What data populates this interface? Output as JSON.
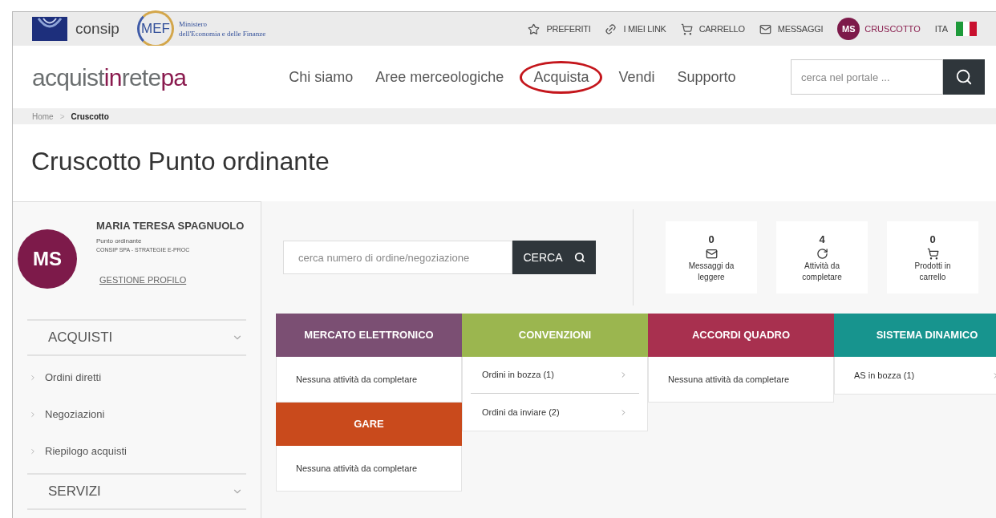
{
  "topbar": {
    "consip": "consip",
    "mef": "MEF",
    "ministry_line_1": "Ministero",
    "ministry_line_2": "dell'Economia e delle Finanze",
    "links": [
      {
        "kind": "star",
        "label": "PREFERITI"
      },
      {
        "kind": "link",
        "label": "I MIEI LINK"
      },
      {
        "kind": "cart",
        "label": "CARRELLO"
      },
      {
        "kind": "mail",
        "label": "MESSAGGI"
      }
    ],
    "user_initials": "MS",
    "dashboard": "CRUSCOTTO",
    "language": "ITA"
  },
  "header": {
    "logo": [
      {
        "text": "acquist",
        "highlighted": false
      },
      {
        "text": "in",
        "highlighted": true
      },
      {
        "text": "rete",
        "highlighted": false
      },
      {
        "text": "pa",
        "highlighted": true
      }
    ],
    "nav": [
      {
        "label": "Chi siamo",
        "circled": false
      },
      {
        "label": "Aree merceologiche",
        "circled": false
      },
      {
        "label": "Acquista",
        "circled": true
      },
      {
        "label": "Vendi",
        "circled": false
      },
      {
        "label": "Supporto",
        "circled": false
      }
    ],
    "search": {
      "placeholder": "cerca nel portale ..."
    }
  },
  "breadcrumb": {
    "separator": ">",
    "items": [
      "Home",
      "Cruscotto"
    ]
  },
  "title": "Cruscotto Punto ordinante",
  "profile": {
    "initials": "MS",
    "name": "MARIA TERESA SPAGNUOLO",
    "role": "Punto ordinante",
    "org": "CONSIP SPA - STRATEGIE E-PROC",
    "link": "GESTIONE PROFILO"
  },
  "menu": [
    {
      "label": "ACQUISTI",
      "items": [
        "Ordini diretti",
        "Negoziazioni",
        "Riepilogo acquisti"
      ]
    },
    {
      "label": "SERVIZI"
    }
  ],
  "order_search": {
    "placeholder": "cerca numero di ordine/negoziazione",
    "button": "CERCA"
  },
  "counters": [
    {
      "kind": "mail",
      "value": "0",
      "label": "Messaggi da leggere"
    },
    {
      "kind": "activity",
      "value": "4",
      "label": "Attività da completare"
    },
    {
      "kind": "cart",
      "value": "0",
      "label": "Prodotti in carrello"
    }
  ],
  "tiles": [
    [
      {
        "title": "MERCATO ELETTRONICO",
        "color": "#7b4f73",
        "entries": [
          {
            "kind": "note",
            "text": "Nessuna attività da completare"
          }
        ]
      },
      {
        "title": "GARE",
        "color": "#c94a1c",
        "entries": [
          {
            "kind": "note",
            "text": "Nessuna attività da completare"
          }
        ]
      }
    ],
    [
      {
        "title": "CONVENZIONI",
        "color": "#9bb64f",
        "entries": [
          {
            "kind": "link",
            "text": "Ordini in bozza (1)"
          },
          {
            "kind": "link",
            "text": "Ordini da inviare (2)"
          }
        ]
      }
    ],
    [
      {
        "title": "ACCORDI QUADRO",
        "color": "#a8304f",
        "entries": [
          {
            "kind": "note",
            "text": "Nessuna attività da completare"
          }
        ]
      }
    ],
    [
      {
        "title": "SISTEMA DINAMICO",
        "color": "#17948e",
        "entries": [
          {
            "kind": "link",
            "text": "AS in bozza (1)"
          }
        ]
      }
    ]
  ]
}
